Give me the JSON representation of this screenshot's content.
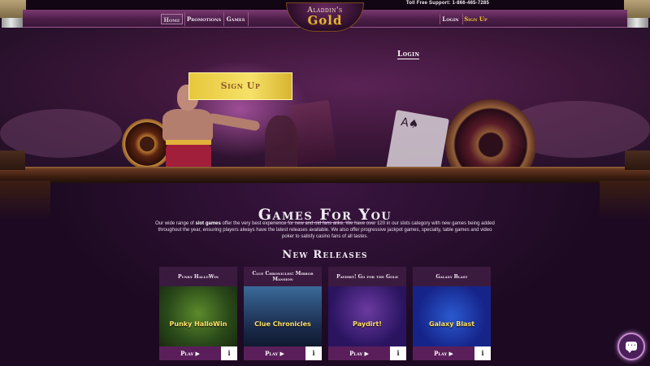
{
  "topbar": {
    "toll_free": "Toll Free Support: 1-866-465-7285"
  },
  "nav": {
    "home": "Home",
    "promotions": "Promotions",
    "games": "Games",
    "login": "Login",
    "signup": "Sign Up"
  },
  "logo": {
    "top": "Aladdin's",
    "main": "Gold"
  },
  "hero": {
    "login": "Login",
    "signup_cta": "Sign Up"
  },
  "games_section": {
    "title": "Games For You",
    "desc_pre": "Our wide range of ",
    "desc_bold": "slot games",
    "desc_post": " offer the very best experience for new and old fans alike. We have over 120 in our slots category with new games being added throughout the year, ensuring players always have the latest releases available. We also offer progressive jackpot games, specialty, table games and video poker to satisfy casino fans of all tastes."
  },
  "new_releases": {
    "title": "New Releases",
    "games": [
      {
        "title": "Punky HalloWin",
        "thumb_text": "Punky HalloWin",
        "play": "Play ▶",
        "info": "i"
      },
      {
        "title": "Clue Chronicles: Mirror Mansion",
        "thumb_text": "Clue Chronicles",
        "play": "Play ▶",
        "info": "i"
      },
      {
        "title": "Paydirt! Go for the Gold",
        "thumb_text": "Paydirt!",
        "play": "Play ▶",
        "info": "i"
      },
      {
        "title": "Galaxy Blast",
        "thumb_text": "Galaxy Blast",
        "play": "Play ▶",
        "info": "i"
      }
    ]
  },
  "icons": {
    "chat": "chat-bubble-icon",
    "info": "info-icon",
    "play": "play-triangle-icon"
  }
}
